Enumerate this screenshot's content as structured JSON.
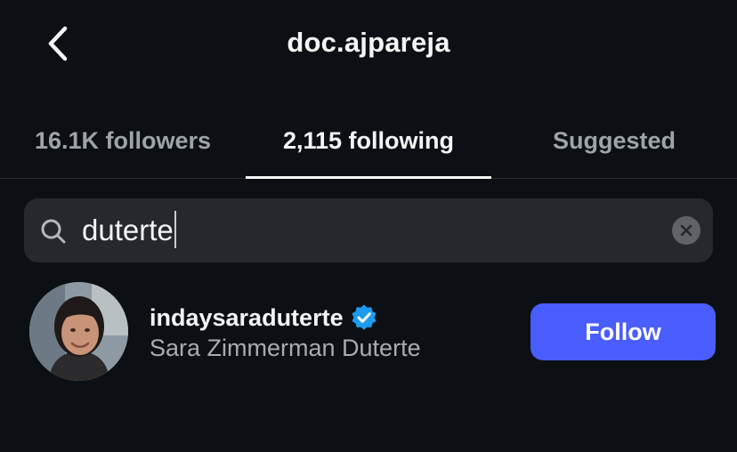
{
  "header": {
    "title": "doc.ajpareja",
    "back_icon": "chevron-left-icon"
  },
  "tabs": [
    {
      "label": "16.1K followers",
      "active": false
    },
    {
      "label": "2,115 following",
      "active": true
    },
    {
      "label": "Suggested",
      "active": false
    }
  ],
  "search": {
    "value": "duterte",
    "search_icon": "search-icon",
    "clear_icon": "clear-icon"
  },
  "results": [
    {
      "username": "indaysaraduterte",
      "verified": true,
      "full_name": "Sara Zimmerman Duterte",
      "action_label": "Follow"
    }
  ],
  "colors": {
    "background": "#0c1014",
    "follow_button": "#4a5dff",
    "verified_badge": "#1d9bf0",
    "search_field": "#25292e",
    "secondary_text": "#a8acb1"
  }
}
